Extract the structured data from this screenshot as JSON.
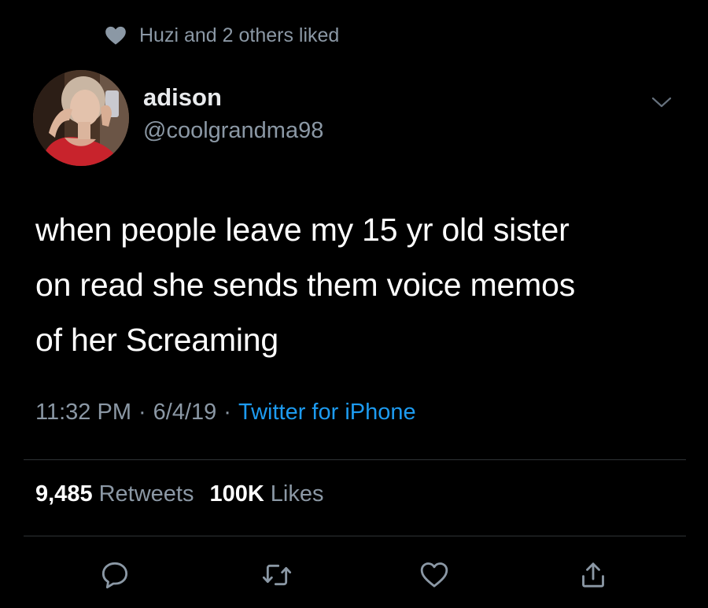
{
  "social_context": {
    "icon": "heart-icon",
    "text": "Huzi and 2 others liked"
  },
  "author": {
    "display_name": "adison",
    "handle": "@coolgrandma98",
    "avatar": "profile-photo"
  },
  "tweet": {
    "text_lines": [
      "when people leave my 15 yr old sister",
      "on read she sends them voice memos",
      "of her Screaming"
    ],
    "time": "11:32 PM",
    "separator": "·",
    "date": "6/4/19",
    "source": "Twitter for iPhone"
  },
  "stats": {
    "retweets_count": "9,485",
    "retweets_label": "Retweets",
    "likes_count": "100K",
    "likes_label": "Likes"
  },
  "actions": [
    {
      "name": "reply",
      "icon": "reply-icon"
    },
    {
      "name": "retweet",
      "icon": "retweet-icon"
    },
    {
      "name": "like",
      "icon": "heart-icon"
    },
    {
      "name": "share",
      "icon": "share-icon"
    }
  ],
  "colors": {
    "background": "#000000",
    "primary_text": "#ffffff",
    "secondary_text": "#8b98a5",
    "link": "#1d9bf0",
    "divider": "#2f3336"
  }
}
